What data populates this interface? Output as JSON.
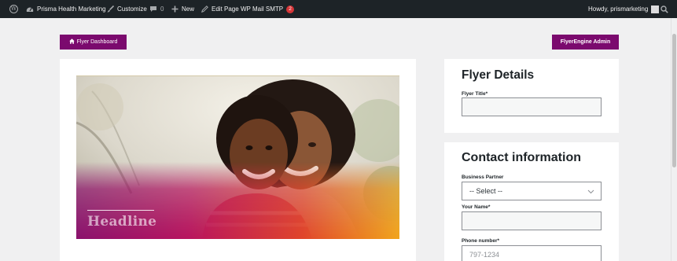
{
  "admin_bar": {
    "site_name": "Prisma Health Marketing",
    "customize": "Customize",
    "comments_count": "0",
    "new": "New",
    "edit_page": "Edit Page",
    "wp_mail_smtp": "WP Mail SMTP",
    "smtp_badge": "2",
    "howdy": "Howdy, prismarketing"
  },
  "buttons": {
    "dashboard": "Flyer Dashboard",
    "admin": "FlyerEngine Admin"
  },
  "flyer": {
    "headline": "Headline"
  },
  "flyer_details": {
    "title": "Flyer Details",
    "flyer_title_label": "Flyer Title*",
    "flyer_title_value": ""
  },
  "contact": {
    "title": "Contact information",
    "business_partner_label": "Business Partner",
    "business_partner_value": "-- Select --",
    "your_name_label": "Your Name*",
    "your_name_value": "",
    "phone_label": "Phone number*",
    "phone_placeholder": "797-1234"
  },
  "colors": {
    "admin_bar_bg": "#1d2327",
    "brand_purple": "#7b0a6e",
    "badge_red": "#d63638",
    "page_bg": "#f0f0f1"
  },
  "icons": {
    "wp_logo": "wordpress-logo-icon",
    "dashboard": "gauge-icon",
    "customize": "paintbrush-icon",
    "comments": "speech-bubble-icon",
    "new": "plus-icon",
    "edit": "pencil-icon",
    "home": "home-icon",
    "search": "search-icon",
    "select": "chevron-down-icon"
  }
}
